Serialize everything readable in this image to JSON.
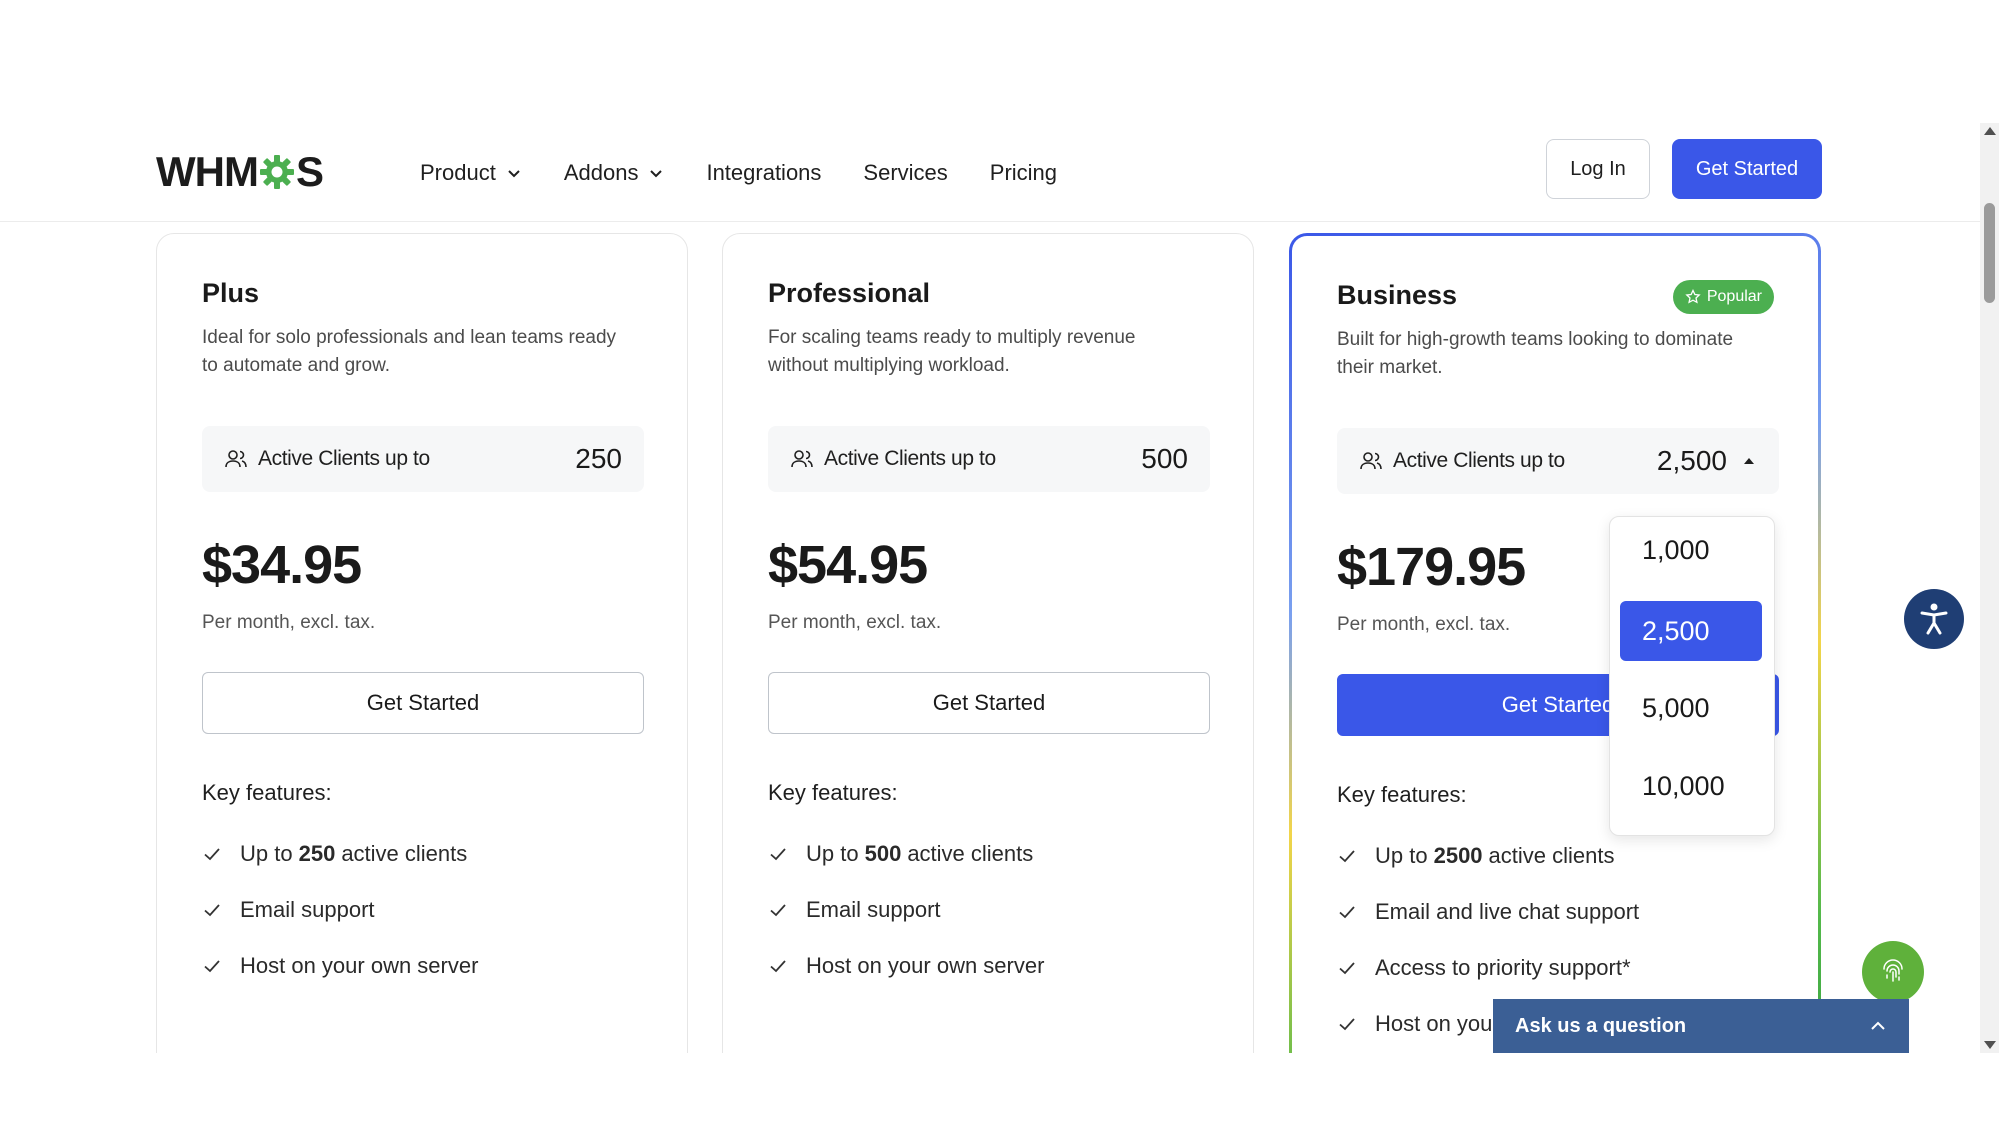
{
  "brand": {
    "logo_prefix": "WHM",
    "logo_suffix": "S",
    "accent": "#3a57e8",
    "logo_green": "#4caf50"
  },
  "nav": {
    "items": [
      {
        "label": "Product",
        "has_dropdown": true
      },
      {
        "label": "Addons",
        "has_dropdown": true
      },
      {
        "label": "Integrations",
        "has_dropdown": false
      },
      {
        "label": "Services",
        "has_dropdown": false
      },
      {
        "label": "Pricing",
        "has_dropdown": false
      }
    ],
    "login_label": "Log In",
    "get_started_label": "Get Started"
  },
  "plans": [
    {
      "name": "Plus",
      "description": "Ideal for solo professionals and lean teams ready to automate and grow.",
      "clients_label": "Active Clients up to",
      "clients_value": "250",
      "price": "$34.95",
      "price_note": "Per month, excl. tax.",
      "button_label": "Get Started",
      "key_features_title": "Key features:",
      "features": [
        {
          "pre": "Up to",
          "bold": "250",
          "post": "active clients"
        },
        {
          "pre": "Email support",
          "bold": "",
          "post": ""
        },
        {
          "pre": "Host on your own server",
          "bold": "",
          "post": ""
        }
      ]
    },
    {
      "name": "Professional",
      "description": "For scaling teams ready to multiply revenue without multiplying workload.",
      "clients_label": "Active Clients up to",
      "clients_value": "500",
      "price": "$54.95",
      "price_note": "Per month, excl. tax.",
      "button_label": "Get Started",
      "key_features_title": "Key features:",
      "features": [
        {
          "pre": "Up to",
          "bold": "500",
          "post": "active clients"
        },
        {
          "pre": "Email support",
          "bold": "",
          "post": ""
        },
        {
          "pre": "Host on your own server",
          "bold": "",
          "post": ""
        }
      ]
    },
    {
      "name": "Business",
      "badge": "Popular",
      "description": "Built for high-growth teams looking to dominate their market.",
      "clients_label": "Active Clients up to",
      "clients_value": "2,500",
      "price": "$179.95",
      "price_note": "Per month, excl. tax.",
      "button_label": "Get Started",
      "key_features_title": "Key features:",
      "features": [
        {
          "pre": "Up to",
          "bold": "2500",
          "post": "active clients"
        },
        {
          "pre": "Email and live chat support",
          "bold": "",
          "post": ""
        },
        {
          "pre": "Access to priority support*",
          "bold": "",
          "post": ""
        },
        {
          "pre": "Host on you",
          "bold": "",
          "post": ""
        }
      ]
    }
  ],
  "clients_dropdown": {
    "options": [
      "1,000",
      "2,500",
      "5,000",
      "10,000"
    ],
    "selected": "2,500"
  },
  "chat": {
    "label": "Ask us a question"
  },
  "icons": {
    "accessibility": "accessibility-icon",
    "fingerprint": "fingerprint-icon",
    "check": "check-icon",
    "user": "users-icon",
    "star": "star-icon"
  }
}
